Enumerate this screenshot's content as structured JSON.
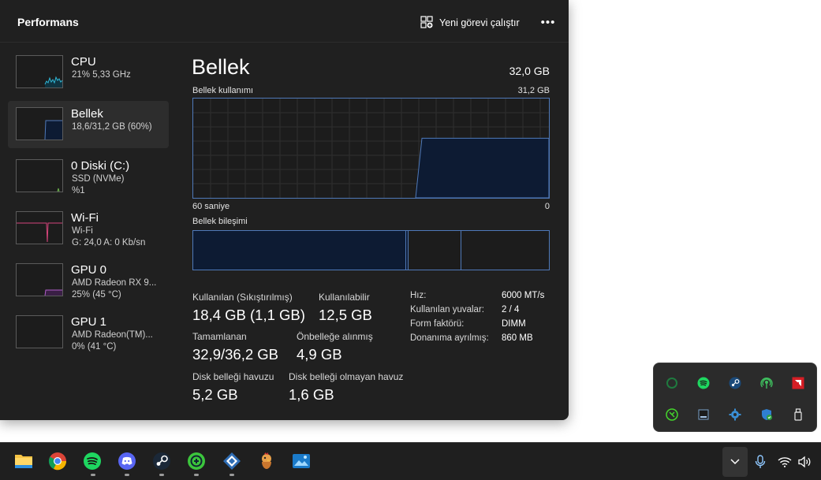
{
  "window": {
    "title": "Performans",
    "run_task_label": "Yeni görevi çalıştır",
    "more_label": "•••"
  },
  "sidebar": {
    "items": [
      {
        "name": "CPU",
        "line1": "21%  5,33 GHz",
        "line2": ""
      },
      {
        "name": "Bellek",
        "line1": "18,6/31,2 GB (60%)",
        "line2": ""
      },
      {
        "name": "0 Diski (C:)",
        "line1": "SSD (NVMe)",
        "line2": "%1"
      },
      {
        "name": "Wi-Fi",
        "line1": "Wi-Fi",
        "line2": "G: 24,0  A: 0 Kb/sn"
      },
      {
        "name": "GPU 0",
        "line1": "AMD Radeon RX 9...",
        "line2": "25%  (45 °C)"
      },
      {
        "name": "GPU 1",
        "line1": "AMD Radeon(TM)...",
        "line2": "0%  (41 °C)"
      }
    ]
  },
  "memory": {
    "title": "Bellek",
    "total": "32,0 GB",
    "usage_label": "Bellek kullanımı",
    "usage_max": "31,2 GB",
    "time_label": "60 saniye",
    "time_end": "0",
    "composition_label": "Bellek bileşimi",
    "usage_fraction": 0.6,
    "stats": {
      "in_use_label": "Kullanılan (Sıkıştırılmış)",
      "in_use_value": "18,4 GB (1,1 GB)",
      "available_label": "Kullanılabilir",
      "available_value": "12,5 GB",
      "committed_label": "Tamamlanan",
      "committed_value": "32,9/36,2 GB",
      "cached_label": "Önbelleğe alınmış",
      "cached_value": "4,9 GB",
      "paged_label": "Disk belleği havuzu",
      "paged_value": "5,2 GB",
      "nonpaged_label": "Disk belleği olmayan havuz",
      "nonpaged_value": "1,6 GB"
    },
    "specs": [
      {
        "label": "Hız:",
        "value": "6000 MT/s"
      },
      {
        "label": "Kullanılan yuvalar:",
        "value": "2 / 4"
      },
      {
        "label": "Form faktörü:",
        "value": "DIMM"
      },
      {
        "label": "Donanıma ayrılmış:",
        "value": "860 MB"
      }
    ]
  },
  "colors": {
    "accent": "#4f79b9",
    "graph_fill": "#0d1b33",
    "cpu_line": "#2fb7d6",
    "wifi_line": "#d5457b",
    "gpu_line": "#b05ec9",
    "disk_line": "#6fb84e"
  },
  "tray_icons": [
    "razer-cortex-icon",
    "spotify-icon",
    "steam-icon",
    "hotspot-icon",
    "amd-icon",
    "razer-synapse-icon",
    "display-icon",
    "settings-gear-icon",
    "defender-icon",
    "usb-drive-icon"
  ],
  "taskbar_apps": [
    "file-explorer-icon",
    "chrome-icon",
    "spotify-icon",
    "discord-icon",
    "steam-icon",
    "vpn-app-icon",
    "sync-app-icon",
    "game-app-icon",
    "photos-app-icon"
  ]
}
